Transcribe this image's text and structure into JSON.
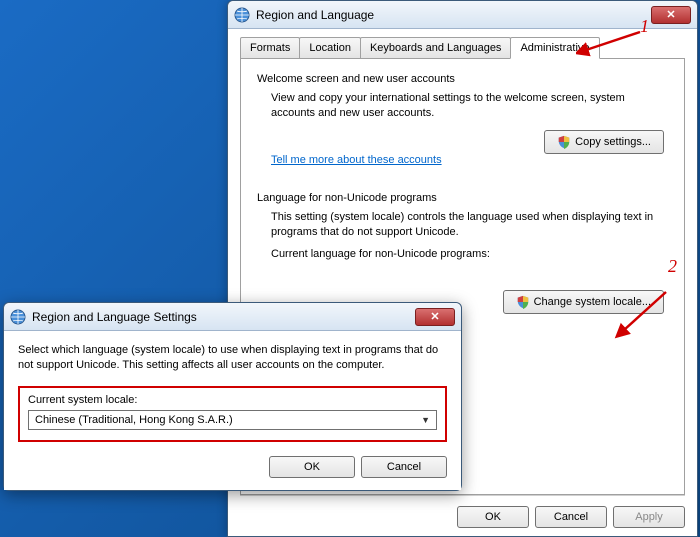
{
  "main": {
    "title": "Region and Language",
    "tabs": [
      "Formats",
      "Location",
      "Keyboards and Languages",
      "Administrative"
    ],
    "group1": {
      "title": "Welcome screen and new user accounts",
      "desc": "View and copy your international settings to the welcome screen, system accounts and new user accounts.",
      "btn": "Copy settings...",
      "link": "Tell me more about these accounts"
    },
    "group2": {
      "title": "Language for non-Unicode programs",
      "desc": "This setting (system locale) controls the language used when displaying text in programs that do not support Unicode.",
      "cur_label": "Current language for non-Unicode programs:",
      "btn": "Change system locale..."
    },
    "buttons": {
      "ok": "OK",
      "cancel": "Cancel",
      "apply": "Apply"
    }
  },
  "sec": {
    "title": "Region and Language Settings",
    "desc": "Select which language (system locale) to use when displaying text in programs that do not support Unicode. This setting affects all user accounts on the computer.",
    "locale_label": "Current system locale:",
    "locale_value": "Chinese (Traditional, Hong Kong S.A.R.)",
    "ok": "OK",
    "cancel": "Cancel"
  },
  "anno": {
    "n1": "1",
    "n2": "2"
  }
}
